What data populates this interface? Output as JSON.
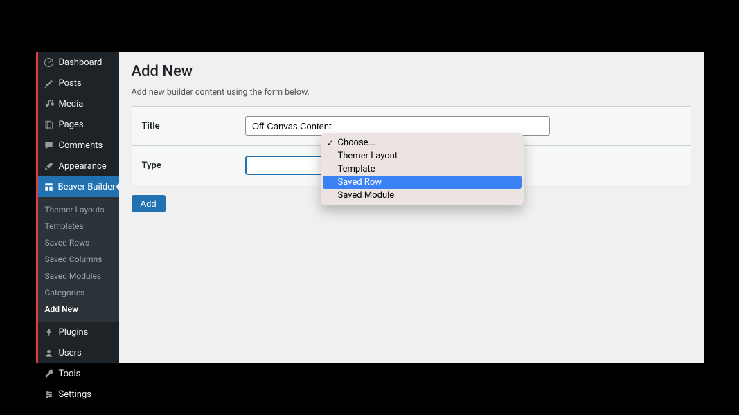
{
  "sidebar": {
    "items": [
      {
        "label": "Dashboard",
        "icon": "dashboard"
      },
      {
        "label": "Posts",
        "icon": "pin"
      },
      {
        "label": "Media",
        "icon": "media"
      },
      {
        "label": "Pages",
        "icon": "pages"
      },
      {
        "label": "Comments",
        "icon": "comment"
      },
      {
        "label": "Appearance",
        "icon": "brush"
      },
      {
        "label": "Beaver Builder",
        "icon": "layout",
        "current": true
      },
      {
        "label": "Plugins",
        "icon": "plug"
      },
      {
        "label": "Users",
        "icon": "user"
      },
      {
        "label": "Tools",
        "icon": "wrench"
      },
      {
        "label": "Settings",
        "icon": "sliders"
      }
    ]
  },
  "submenu": {
    "items": [
      {
        "label": "Themer Layouts"
      },
      {
        "label": "Templates"
      },
      {
        "label": "Saved Rows"
      },
      {
        "label": "Saved Columns"
      },
      {
        "label": "Saved Modules"
      },
      {
        "label": "Categories"
      },
      {
        "label": "Add New",
        "current": true
      }
    ]
  },
  "page": {
    "title": "Add New",
    "description": "Add new builder content using the form below."
  },
  "form": {
    "title_label": "Title",
    "title_value": "Off-Canvas Content",
    "type_label": "Type",
    "add_button": "Add"
  },
  "dropdown": {
    "options": [
      {
        "label": "Choose...",
        "selected": true
      },
      {
        "label": "Themer Layout"
      },
      {
        "label": "Template"
      },
      {
        "label": "Saved Row",
        "highlight": true
      },
      {
        "label": "Saved Module"
      }
    ]
  }
}
